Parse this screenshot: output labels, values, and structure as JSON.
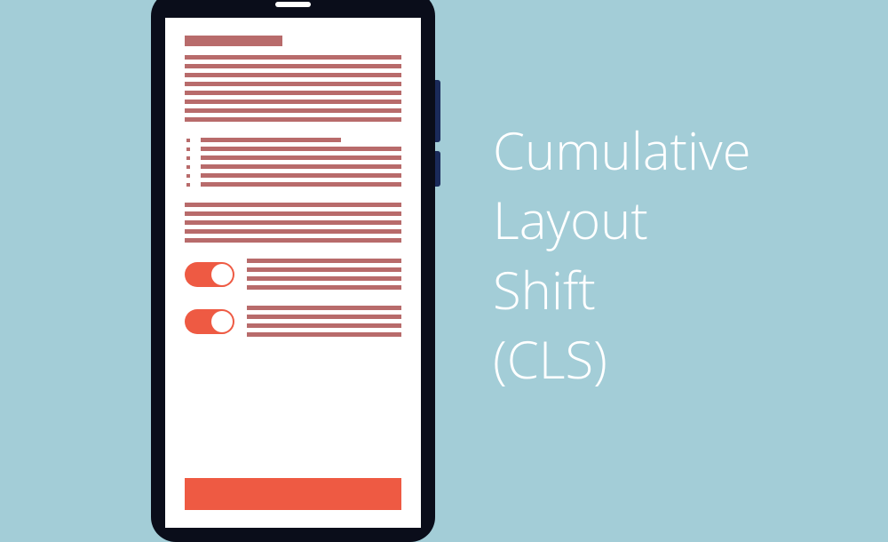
{
  "title": {
    "line1": "Cumulative",
    "line2": "Layout",
    "line3": "Shift",
    "line4": "(CLS)"
  },
  "colors": {
    "background": "#a3cdd7",
    "phone_body": "#0a0d1a",
    "text_lines": "#b86b6b",
    "accent": "#ee5a43",
    "title_text": "#ffffff"
  }
}
